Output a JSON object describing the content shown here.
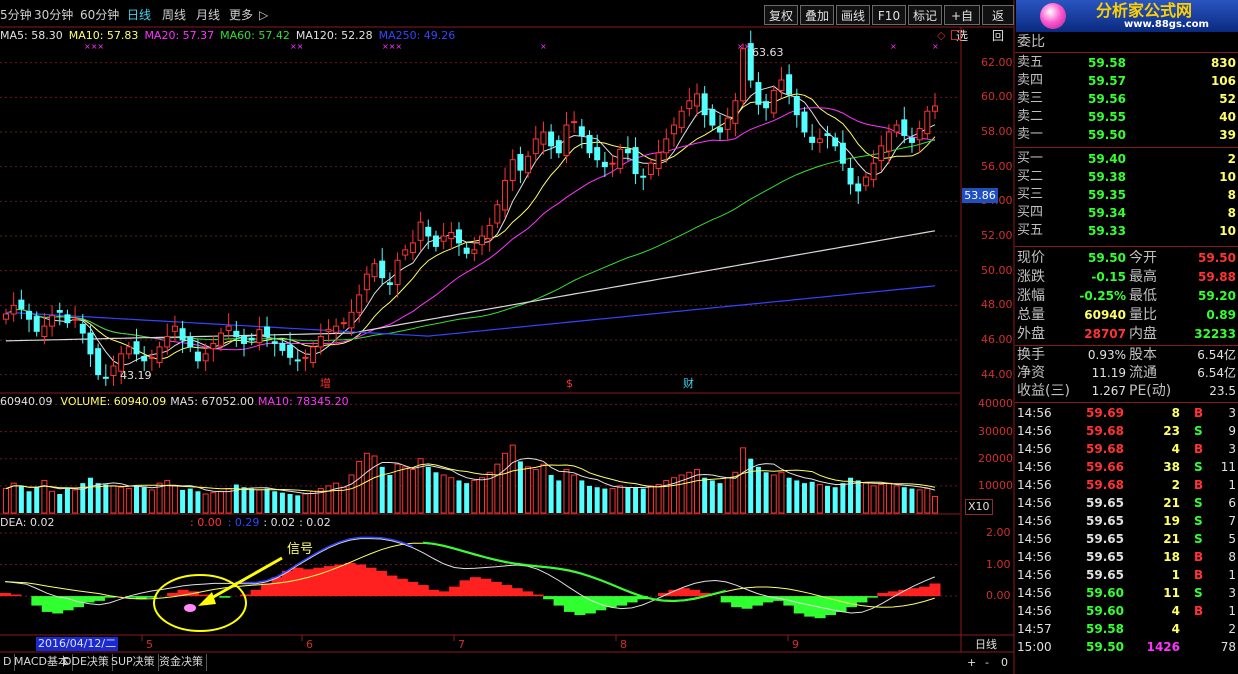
{
  "toolbar": {
    "periods": [
      "5分钟",
      "30分钟",
      "60分钟",
      "日线",
      "周线",
      "月线",
      "更多"
    ],
    "active_period": "日线",
    "more_arrow": "▷",
    "buttons": [
      "复权",
      "叠加",
      "画线",
      "F10",
      "标记",
      "+自选",
      "返回"
    ]
  },
  "logo": {
    "title": "分析家公式网",
    "url": "www.88gs.com"
  },
  "main_chart": {
    "ma_legend": [
      {
        "label": "MA5: 58.30",
        "color": "#e0e0e0"
      },
      {
        "label": "MA10: 57.83",
        "color": "#ffff66"
      },
      {
        "label": "MA20: 57.37",
        "color": "#ff33ff"
      },
      {
        "label": "MA60: 57.42",
        "color": "#33dd33"
      },
      {
        "label": "MA120: 52.28",
        "color": "#e0e0e0"
      },
      {
        "label": "MA250: 49.26",
        "color": "#3344ff"
      }
    ],
    "y_ticks": [
      "62.00",
      "60.00",
      "58.00",
      "56.00",
      "54.00",
      "52.00",
      "50.00",
      "48.00",
      "46.00",
      "44.00"
    ],
    "high_label": "63.63",
    "low_label": "43.19",
    "current_price_tag": "53.86",
    "event_labels": [
      "增",
      "$",
      "财"
    ]
  },
  "volume_chart": {
    "legend_value": "60940.09",
    "legend_volume": "VOLUME: 60940.09",
    "legend_ma5": "MA5: 67052.00",
    "legend_ma10": "MA10: 78345.20",
    "y_ticks": [
      "40000",
      "30000",
      "20000",
      "10000"
    ],
    "multiplier": "X10"
  },
  "macd_chart": {
    "legend_dea": "DEA: 0.02",
    "legend_vals": [
      ": 0.00",
      ": 0.29",
      ": 0.02",
      ": 0.02"
    ],
    "y_ticks": [
      "2.00",
      "1.00",
      "0.00"
    ],
    "signal_label": "信号"
  },
  "date_axis": {
    "cursor_date": "2016/04/12/二",
    "months": [
      "5",
      "6",
      "7",
      "8",
      "9"
    ],
    "period_label": "日线"
  },
  "bottom_tabs": [
    "MACD基本",
    "DDE决策",
    "SUP决策",
    "资金决策"
  ],
  "bottom_tab_prefix": "D",
  "scroll_controls": [
    "+",
    "-",
    "0"
  ],
  "order_book": {
    "header": "委比",
    "sells": [
      {
        "label": "卖五",
        "price": "59.58",
        "vol": "830"
      },
      {
        "label": "卖四",
        "price": "59.57",
        "vol": "106"
      },
      {
        "label": "卖三",
        "price": "59.56",
        "vol": "52"
      },
      {
        "label": "卖二",
        "price": "59.55",
        "vol": "40"
      },
      {
        "label": "卖一",
        "price": "59.50",
        "vol": "39"
      }
    ],
    "buys": [
      {
        "label": "买一",
        "price": "59.40",
        "vol": "2"
      },
      {
        "label": "买二",
        "price": "59.38",
        "vol": "10"
      },
      {
        "label": "买三",
        "price": "59.35",
        "vol": "8"
      },
      {
        "label": "买四",
        "price": "59.34",
        "vol": "8"
      },
      {
        "label": "买五",
        "price": "59.33",
        "vol": "10"
      }
    ]
  },
  "quote": [
    {
      "l1": "现价",
      "v1": "59.50",
      "c1": "#33ff33",
      "l2": "今开",
      "v2": "59.50",
      "c2": "#ff3333"
    },
    {
      "l1": "涨跌",
      "v1": "-0.15",
      "c1": "#33ff33",
      "l2": "最高",
      "v2": "59.88",
      "c2": "#ff3333"
    },
    {
      "l1": "涨幅",
      "v1": "-0.25%",
      "c1": "#33ff33",
      "l2": "最低",
      "v2": "59.20",
      "c2": "#33ff33"
    },
    {
      "l1": "总量",
      "v1": "60940",
      "c1": "#ffff66",
      "l2": "量比",
      "v2": "0.89",
      "c2": "#33ff33"
    },
    {
      "l1": "外盘",
      "v1": "28707",
      "c1": "#ff3333",
      "l2": "内盘",
      "v2": "32233",
      "c2": "#33ff33"
    }
  ],
  "stats": [
    {
      "l1": "换手",
      "v1": "0.93%",
      "l2": "股本",
      "v2": "6.54亿"
    },
    {
      "l1": "净资",
      "v1": "11.19",
      "l2": "流通",
      "v2": "6.54亿"
    },
    {
      "l1": "收益(三)",
      "v1": "1.267",
      "l2": "PE(动)",
      "v2": "23.5"
    }
  ],
  "ticks": [
    {
      "time": "14:56",
      "price": "59.69",
      "vol": "8",
      "side": "B",
      "n": "3"
    },
    {
      "time": "14:56",
      "price": "59.68",
      "vol": "23",
      "side": "S",
      "n": "9"
    },
    {
      "time": "14:56",
      "price": "59.68",
      "vol": "4",
      "side": "B",
      "n": "3"
    },
    {
      "time": "14:56",
      "price": "59.66",
      "vol": "38",
      "side": "S",
      "n": "11"
    },
    {
      "time": "14:56",
      "price": "59.68",
      "vol": "2",
      "side": "B",
      "n": "1"
    },
    {
      "time": "14:56",
      "price": "59.65",
      "vol": "21",
      "side": "S",
      "n": "6"
    },
    {
      "time": "14:56",
      "price": "59.65",
      "vol": "19",
      "side": "S",
      "n": "7"
    },
    {
      "time": "14:56",
      "price": "59.65",
      "vol": "21",
      "side": "S",
      "n": "5"
    },
    {
      "time": "14:56",
      "price": "59.65",
      "vol": "18",
      "side": "B",
      "n": "8"
    },
    {
      "time": "14:56",
      "price": "59.65",
      "vol": "1",
      "side": "B",
      "n": "1"
    },
    {
      "time": "14:56",
      "price": "59.60",
      "vol": "11",
      "side": "S",
      "n": "3"
    },
    {
      "time": "14:56",
      "price": "59.60",
      "vol": "4",
      "side": "B",
      "n": "1"
    },
    {
      "time": "14:57",
      "price": "59.58",
      "vol": "4",
      "side": "",
      "n": "2"
    },
    {
      "time": "15:00",
      "price": "59.50",
      "vol": "1426",
      "side": "",
      "n": "78"
    }
  ],
  "chart_data": {
    "type": "candlestick",
    "price_axis": {
      "ylim": [
        43,
        64
      ],
      "ticks": [
        44,
        46,
        48,
        50,
        52,
        54,
        56,
        58,
        60,
        62
      ]
    },
    "volume_axis": {
      "ylim": [
        0,
        42000
      ],
      "ticks": [
        10000,
        20000,
        30000,
        40000
      ]
    },
    "macd_axis": {
      "ylim": [
        -1.2,
        2.6
      ],
      "ticks": [
        0,
        1,
        2
      ]
    },
    "months": [
      "5",
      "6",
      "7",
      "8",
      "9"
    ],
    "closes": [
      47.5,
      48.0,
      47.8,
      47.2,
      46.5,
      46.8,
      47.4,
      47.6,
      47.0,
      47.2,
      46.4,
      45.2,
      44.0,
      43.8,
      44.5,
      45.2,
      45.6,
      45.2,
      44.8,
      45.0,
      45.6,
      46.2,
      46.8,
      46.0,
      45.6,
      44.8,
      45.2,
      45.8,
      46.4,
      46.8,
      46.2,
      45.8,
      46.0,
      46.6,
      46.2,
      45.8,
      45.4,
      45.0,
      44.8,
      45.0,
      45.6,
      46.2,
      46.6,
      46.8,
      47.0,
      47.6,
      48.6,
      49.8,
      50.4,
      49.6,
      49.2,
      50.6,
      51.2,
      51.6,
      52.8,
      52.0,
      51.4,
      52.0,
      52.2,
      51.6,
      51.0,
      51.2,
      52.0,
      52.6,
      53.8,
      55.2,
      56.4,
      55.8,
      56.6,
      57.6,
      58.0,
      57.2,
      56.8,
      58.4,
      58.6,
      57.8,
      56.8,
      56.4,
      56.0,
      56.2,
      57.0,
      56.8,
      55.6,
      55.4,
      56.2,
      56.8,
      57.6,
      58.4,
      59.2,
      59.8,
      60.2,
      59.0,
      58.4,
      58.0,
      58.8,
      59.8,
      62.8,
      61.0,
      59.6,
      59.4,
      60.4,
      61.0,
      60.2,
      59.0,
      58.0,
      57.4,
      57.6,
      57.8,
      57.2,
      56.2,
      55.0,
      54.6,
      55.4,
      56.2,
      57.2,
      58.0,
      58.4,
      57.8,
      57.4,
      58.2,
      59.2,
      59.5
    ],
    "volumes": [
      9000,
      11000,
      10000,
      8000,
      9500,
      12000,
      8000,
      7000,
      9000,
      8500,
      11000,
      13000,
      11000,
      10500,
      10000,
      9500,
      9000,
      10000,
      9500,
      8500,
      11000,
      12000,
      10000,
      8500,
      9000,
      8000,
      7000,
      7500,
      8000,
      9000,
      10500,
      9500,
      9000,
      8500,
      9000,
      8000,
      7500,
      7000,
      6500,
      7000,
      8000,
      9000,
      10000,
      11000,
      9500,
      14000,
      19000,
      22000,
      21000,
      17000,
      14000,
      18000,
      17000,
      16000,
      20000,
      17000,
      15000,
      14000,
      13000,
      12000,
      11000,
      12000,
      13000,
      15000,
      18000,
      22000,
      25000,
      19000,
      17000,
      16000,
      18000,
      14000,
      12000,
      16000,
      14000,
      12000,
      10000,
      9500,
      9000,
      9000,
      10000,
      9500,
      9500,
      9000,
      10000,
      10500,
      12000,
      13000,
      14000,
      15000,
      16000,
      13000,
      12000,
      11000,
      13000,
      15000,
      24000,
      20000,
      17000,
      15000,
      14000,
      15000,
      13000,
      12000,
      11000,
      11500,
      10500,
      10000,
      9500,
      11000,
      13000,
      12000,
      11000,
      10000,
      10500,
      11000,
      10000,
      9500,
      9000,
      8500,
      9000,
      6100
    ],
    "macd_hist": [
      0.1,
      0.05,
      0.0,
      -0.3,
      -0.5,
      -0.55,
      -0.45,
      -0.35,
      -0.2,
      -0.15,
      -0.05,
      0.0,
      -0.05,
      -0.1,
      -0.05,
      0.0,
      0.1,
      0.2,
      0.15,
      0.05,
      0.0,
      -0.05,
      0.0,
      0.05,
      0.2,
      0.4,
      0.6,
      0.8,
      0.9,
      0.85,
      0.9,
      0.95,
      1.0,
      1.05,
      1.0,
      0.9,
      0.8,
      0.65,
      0.55,
      0.45,
      0.35,
      0.2,
      0.15,
      0.3,
      0.5,
      0.6,
      0.55,
      0.45,
      0.35,
      0.25,
      0.15,
      0.05,
      -0.1,
      -0.3,
      -0.5,
      -0.6,
      -0.55,
      -0.45,
      -0.35,
      -0.3,
      -0.2,
      -0.1,
      0.0,
      0.1,
      0.2,
      0.25,
      0.2,
      0.1,
      0.0,
      -0.2,
      -0.35,
      -0.4,
      -0.3,
      -0.2,
      -0.15,
      -0.3,
      -0.55,
      -0.65,
      -0.7,
      -0.6,
      -0.5,
      -0.35,
      -0.2,
      -0.05,
      0.1,
      0.15,
      0.2,
      0.25,
      0.3,
      0.4
    ],
    "series": [
      {
        "name": "MA5",
        "color": "#e0e0e0"
      },
      {
        "name": "MA10",
        "color": "#ffff66"
      },
      {
        "name": "MA20",
        "color": "#ff33ff"
      },
      {
        "name": "MA60",
        "color": "#33dd33"
      },
      {
        "name": "MA120",
        "color": "#e0e0e0"
      },
      {
        "name": "MA250",
        "color": "#3344ff"
      }
    ]
  }
}
